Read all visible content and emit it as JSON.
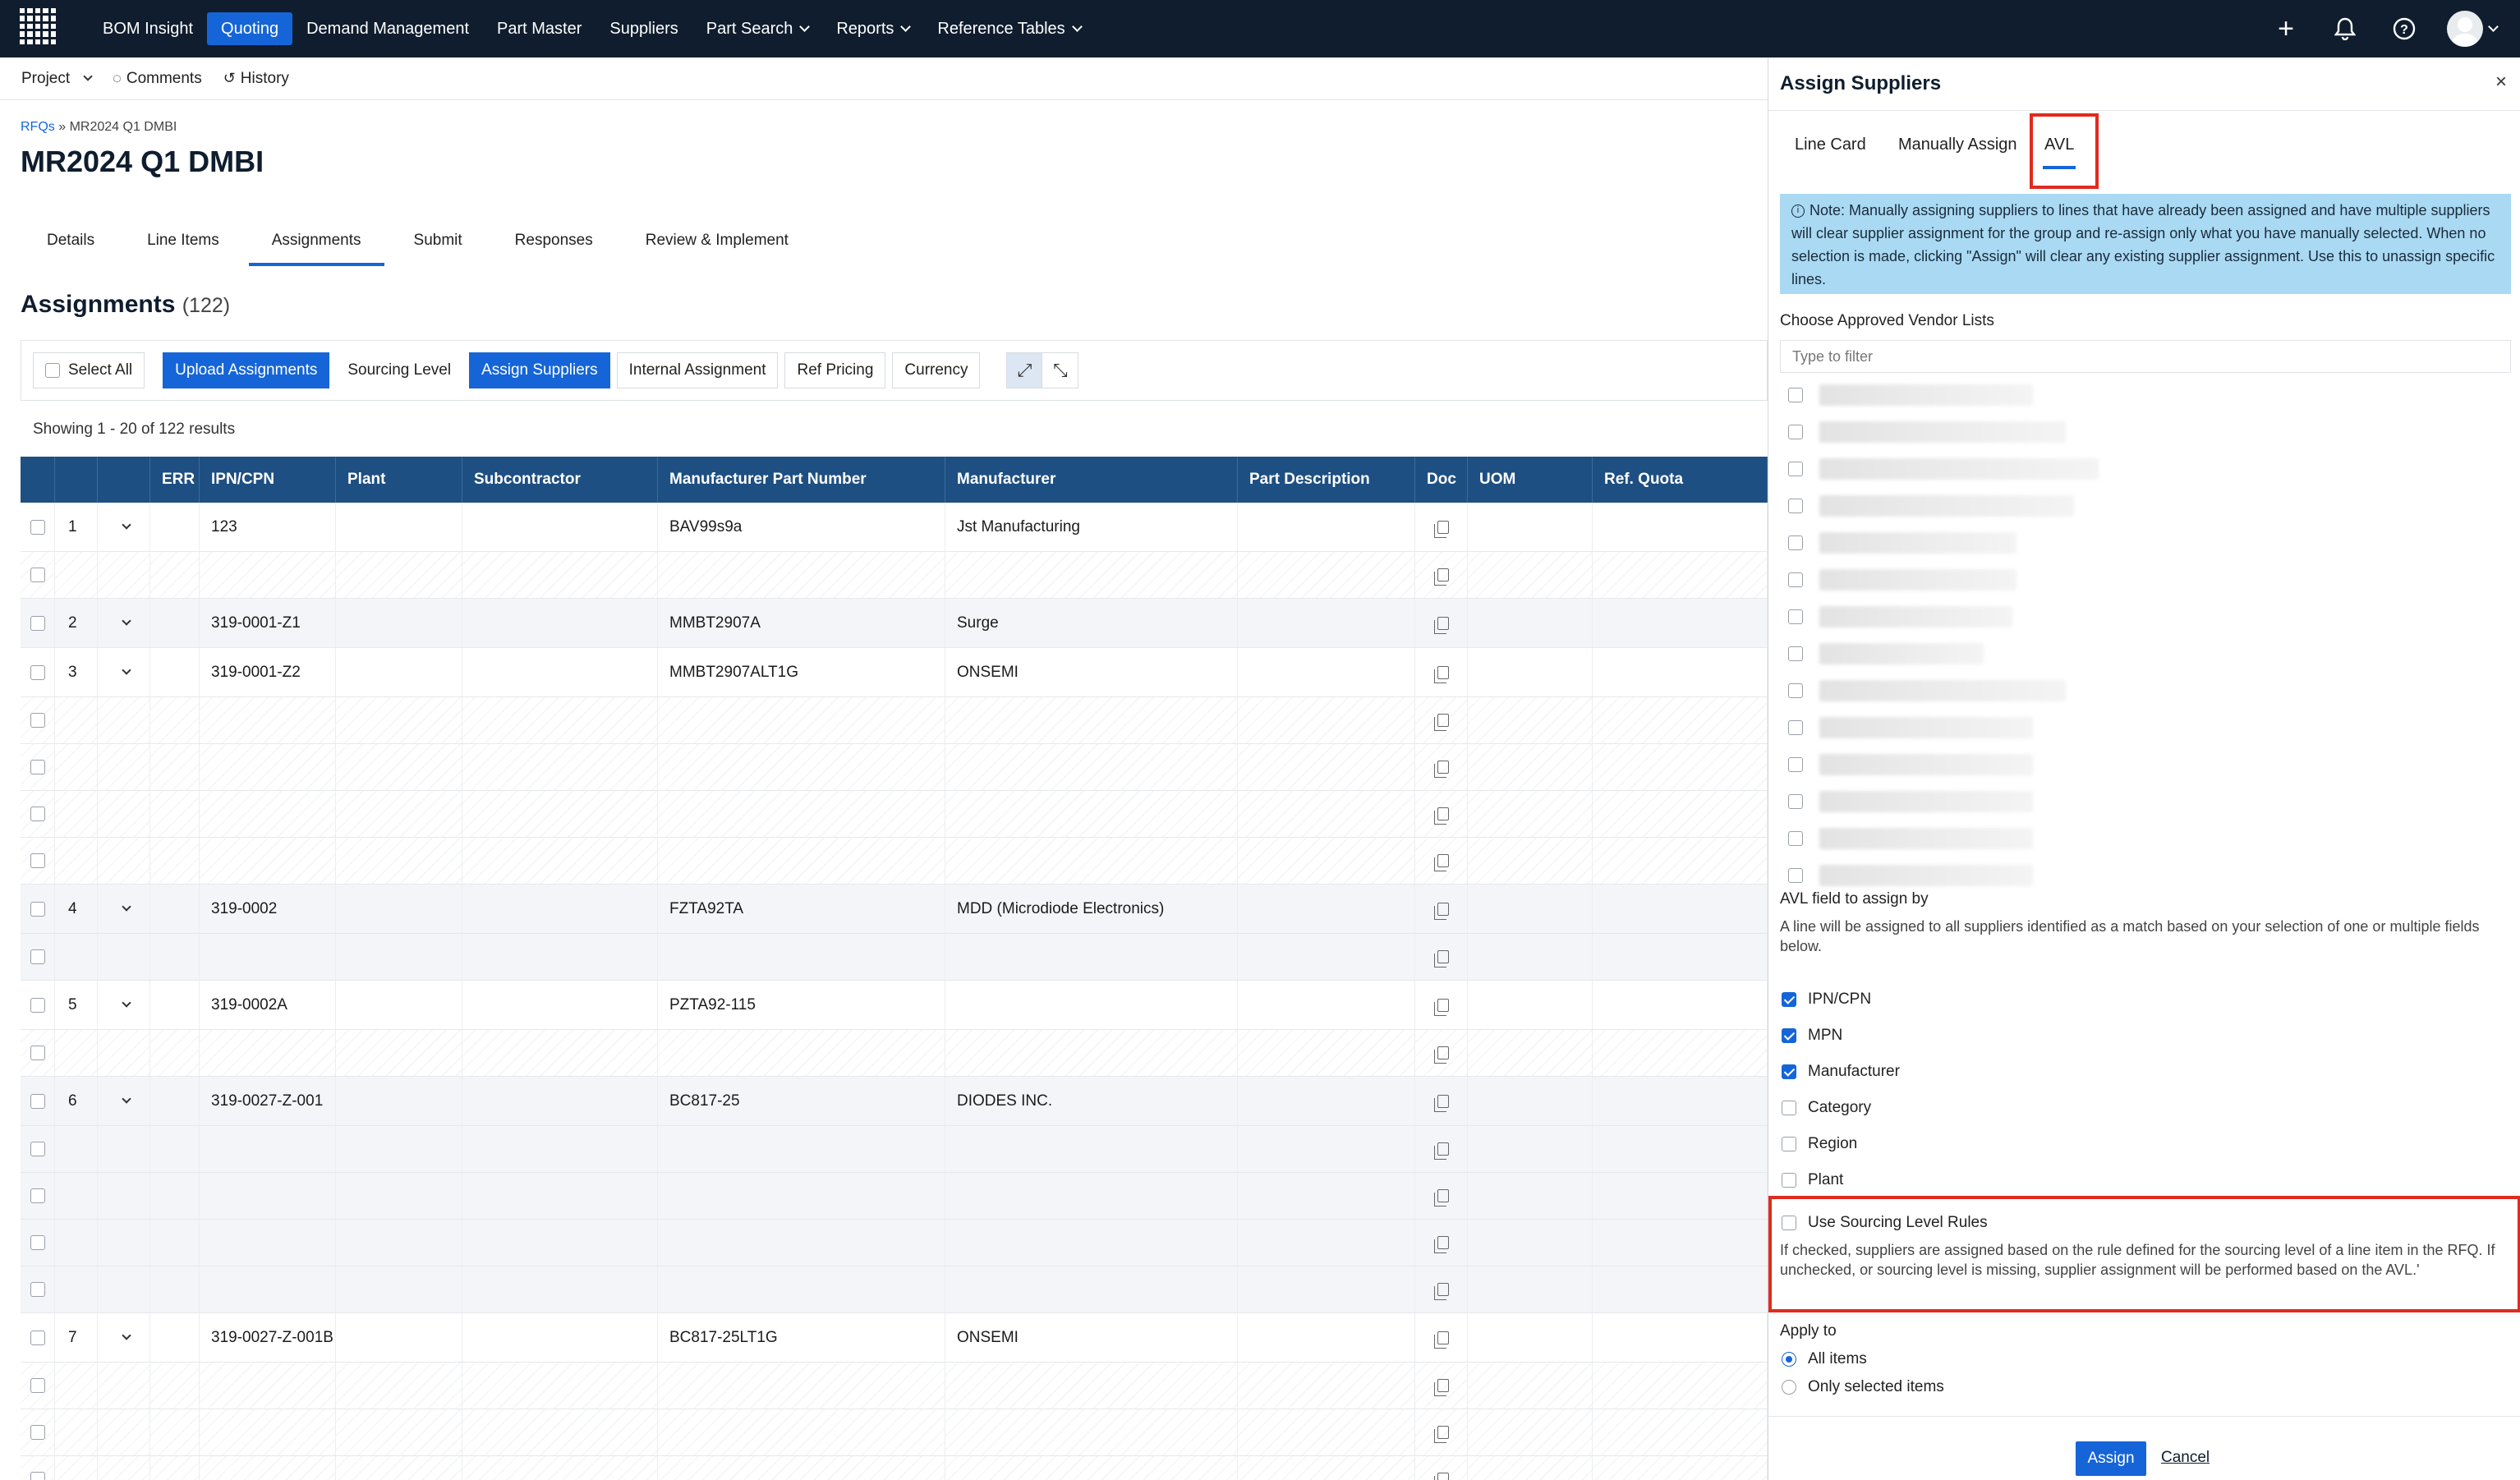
{
  "nav": {
    "items": [
      {
        "label": "BOM Insight",
        "active": false,
        "dropdown": false
      },
      {
        "label": "Quoting",
        "active": true,
        "dropdown": false
      },
      {
        "label": "Demand Management",
        "active": false,
        "dropdown": false
      },
      {
        "label": "Part Master",
        "active": false,
        "dropdown": false
      },
      {
        "label": "Suppliers",
        "active": false,
        "dropdown": false
      },
      {
        "label": "Part Search",
        "active": false,
        "dropdown": true
      },
      {
        "label": "Reports",
        "active": false,
        "dropdown": true
      },
      {
        "label": "Reference Tables",
        "active": false,
        "dropdown": true
      }
    ],
    "icons": [
      "plus-icon",
      "bell-icon",
      "help-icon",
      "avatar"
    ]
  },
  "subbar": {
    "project": "Project",
    "comments": "Comments",
    "history": "History"
  },
  "breadcrumb": {
    "root": "RFQs",
    "separator": "»",
    "current": "MR2024 Q1 DMBI"
  },
  "page_title": "MR2024 Q1 DMBI",
  "tabs": [
    {
      "label": "Details",
      "active": false
    },
    {
      "label": "Line Items",
      "active": false
    },
    {
      "label": "Assignments",
      "active": true
    },
    {
      "label": "Submit",
      "active": false
    },
    {
      "label": "Responses",
      "active": false
    },
    {
      "label": "Review & Implement",
      "active": false
    }
  ],
  "section": {
    "title": "Assignments",
    "count": "(122)"
  },
  "toolbar": {
    "select_all": "Select All",
    "upload": "Upload Assignments",
    "sourcing_level": "Sourcing Level",
    "assign_suppliers": "Assign Suppliers",
    "internal_assignment": "Internal Assignment",
    "ref_pricing": "Ref Pricing",
    "currency": "Currency"
  },
  "showing": "Showing 1 - 20 of 122 results",
  "table": {
    "columns": [
      "",
      "",
      "",
      "ERR",
      "IPN/CPN",
      "Plant",
      "Subcontractor",
      "Manufacturer Part Number",
      "Manufacturer",
      "Part Description",
      "Doc",
      "UOM",
      "Ref. Quota"
    ],
    "rows": [
      {
        "num": "1",
        "ipn": "123",
        "mpn": "BAV99s9a",
        "mfr": "Jst Manufacturing",
        "type": "main",
        "alt": false
      },
      {
        "num": "",
        "ipn": "",
        "mpn": "",
        "mfr": "",
        "type": "sub",
        "alt": false
      },
      {
        "num": "2",
        "ipn": "319-0001-Z1",
        "mpn": "MMBT2907A",
        "mfr": "Surge",
        "type": "main",
        "alt": true
      },
      {
        "num": "3",
        "ipn": "319-0001-Z2",
        "mpn": "MMBT2907ALT1G",
        "mfr": "ONSEMI",
        "type": "main",
        "alt": false
      },
      {
        "num": "",
        "ipn": "",
        "mpn": "",
        "mfr": "",
        "type": "sub",
        "alt": false
      },
      {
        "num": "",
        "ipn": "",
        "mpn": "",
        "mfr": "",
        "type": "sub",
        "alt": false
      },
      {
        "num": "",
        "ipn": "",
        "mpn": "",
        "mfr": "",
        "type": "sub",
        "alt": false
      },
      {
        "num": "",
        "ipn": "",
        "mpn": "",
        "mfr": "",
        "type": "sub",
        "alt": false
      },
      {
        "num": "4",
        "ipn": "319-0002",
        "mpn": "FZTA92TA",
        "mfr": "MDD (Microdiode Electronics)",
        "type": "main",
        "alt": true
      },
      {
        "num": "",
        "ipn": "",
        "mpn": "",
        "mfr": "",
        "type": "sub",
        "alt": true
      },
      {
        "num": "5",
        "ipn": "319-0002A",
        "mpn": "PZTA92-115",
        "mfr": "",
        "type": "main",
        "alt": false
      },
      {
        "num": "",
        "ipn": "",
        "mpn": "",
        "mfr": "",
        "type": "sub",
        "alt": false
      },
      {
        "num": "6",
        "ipn": "319-0027-Z-001",
        "mpn": "BC817-25",
        "mfr": "DIODES INC.",
        "type": "main",
        "alt": true
      },
      {
        "num": "",
        "ipn": "",
        "mpn": "",
        "mfr": "",
        "type": "sub",
        "alt": true
      },
      {
        "num": "",
        "ipn": "",
        "mpn": "",
        "mfr": "",
        "type": "sub",
        "alt": true
      },
      {
        "num": "",
        "ipn": "",
        "mpn": "",
        "mfr": "",
        "type": "sub",
        "alt": true
      },
      {
        "num": "",
        "ipn": "",
        "mpn": "",
        "mfr": "",
        "type": "sub",
        "alt": true
      },
      {
        "num": "7",
        "ipn": "319-0027-Z-001B",
        "mpn": "BC817-25LT1G",
        "mfr": "ONSEMI",
        "type": "main",
        "alt": false
      },
      {
        "num": "",
        "ipn": "",
        "mpn": "",
        "mfr": "",
        "type": "sub",
        "alt": false
      },
      {
        "num": "",
        "ipn": "",
        "mpn": "",
        "mfr": "",
        "type": "sub",
        "alt": false
      },
      {
        "num": "",
        "ipn": "",
        "mpn": "",
        "mfr": "",
        "type": "sub",
        "alt": false
      }
    ]
  },
  "panel": {
    "title": "Assign Suppliers",
    "tabs": [
      {
        "label": "Line Card",
        "active": false
      },
      {
        "label": "Manually Assign",
        "active": false
      },
      {
        "label": "AVL",
        "active": true
      }
    ],
    "note": "Note: Manually assigning suppliers to lines that have already been assigned and have multiple suppliers will clear supplier assignment for the group and re-assign only what you have manually selected. When no selection is made, clicking \"Assign\" will clear any existing supplier assignment. Use this to unassign specific lines.",
    "avl_label": "Choose Approved Vendor Lists",
    "filter_placeholder": "Type to filter",
    "avl_field_label": "AVL field to assign by",
    "avl_field_help": "A line will be assigned to all suppliers identified as a match based on your selection of one or multiple fields below.",
    "fields": [
      {
        "label": "IPN/CPN",
        "checked": true
      },
      {
        "label": "MPN",
        "checked": true
      },
      {
        "label": "Manufacturer",
        "checked": true
      },
      {
        "label": "Category",
        "checked": false
      },
      {
        "label": "Region",
        "checked": false
      },
      {
        "label": "Plant",
        "checked": false
      }
    ],
    "sourcing_rules_label": "Use Sourcing Level Rules",
    "sourcing_rules_help": "If checked, suppliers are assigned based on the rule defined for the sourcing level of a line item in the RFQ. If unchecked, or sourcing level is missing, supplier assignment will be performed based on the AVL.'",
    "apply_to_label": "Apply to",
    "apply_options": [
      {
        "label": "All items",
        "selected": true
      },
      {
        "label": "Only selected items",
        "selected": false
      }
    ],
    "assign_button": "Assign",
    "cancel_link": "Cancel"
  },
  "colors": {
    "nav_bg": "#0f1d2e",
    "accent": "#1565d8",
    "table_header": "#1e4f82",
    "note_bg": "#a9d9f3",
    "highlight": "#e02b20"
  }
}
